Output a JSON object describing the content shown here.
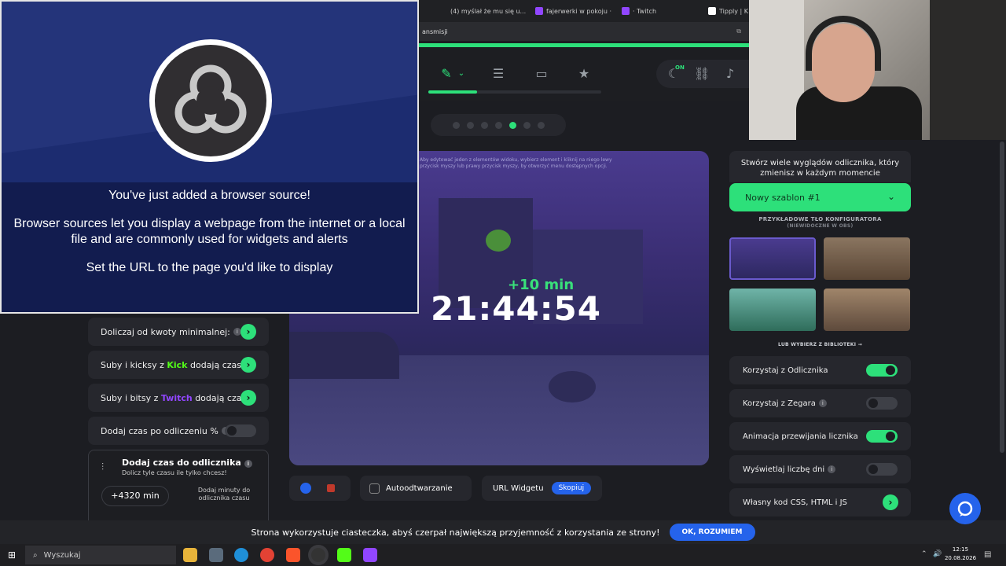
{
  "browser": {
    "tabs": [
      {
        "label": "(4) myślał że mu się u...",
        "color": "#ff0000"
      },
      {
        "label": "fajerwerki w pokoju ·",
        "color": "#9146ff"
      },
      {
        "label": "· Twitch",
        "color": "#9146ff"
      },
      {
        "label": "Tipply | K",
        "color": "#ffffff"
      }
    ],
    "address": "ansmisji"
  },
  "toolbar": {
    "on_badge": "ON"
  },
  "obs": {
    "line1": "You've just added a browser source!",
    "line2": "Browser sources let you display a webpage from the internet or a local file and are commonly used for widgets and alerts",
    "line3": "Set the URL to the page you'd like to display"
  },
  "preview": {
    "hint": "Aby edytować jeden z elementów widoku, wybierz element i kliknij na niego lewy przycisk myszy lub prawy przycisk myszy, by otworzyć menu dostępnych opcji.",
    "plus": "+10 min",
    "timer": "21:44:54"
  },
  "left_panel": {
    "row1": "Doliczaj od kwoty minimalnej:",
    "row2_pre": "Suby i kicksy z",
    "row2_brand": "Kick",
    "row2_post": "dodają czas",
    "row3_pre": "Suby i bitsy z",
    "row3_brand": "Twitch",
    "row3_post": "dodają czas",
    "row4": "Dodaj czas po odliczeniu %",
    "add_title": "Dodaj czas do odlicznika",
    "add_sub": "Dolicz tyle czasu ile tylko chcesz!",
    "add_value": "+4320 min",
    "add_hint": "Dodaj minuty do odlicznika czasu"
  },
  "controls": {
    "autoplay": "Autoodtwarzanie",
    "url_label": "URL Widgetu",
    "copy": "Skopiuj"
  },
  "right_panel": {
    "header": "Stwórz wiele wyglądów odlicznika, który zmienisz w każdym momencie",
    "template": "Nowy szablon #1",
    "bg_caption": "PRZYKŁADOWE TŁO KONFIGURATORA",
    "bg_sub": "(NIEWIDOCZNE W OBS)",
    "library": "LUB WYBIERZ Z BIBLIOTEKI",
    "options": [
      {
        "label": "Korzystaj z Odlicznika",
        "on": true
      },
      {
        "label": "Korzystaj z Zegara",
        "on": false
      },
      {
        "label": "Animacja przewijania licznika",
        "on": true
      },
      {
        "label": "Wyświetlaj liczbę dni",
        "on": false
      }
    ],
    "custom_code": "Własny kod CSS, HTML i JS"
  },
  "cookie": {
    "text": "Strona wykorzystuje ciasteczka, abyś czerpał największą przyjemność z korzystania ze strony!",
    "ok": "OK, ROZUMIEM"
  },
  "taskbar": {
    "search": "Wyszukaj",
    "time": "12:15",
    "date": "20.08.2026"
  }
}
